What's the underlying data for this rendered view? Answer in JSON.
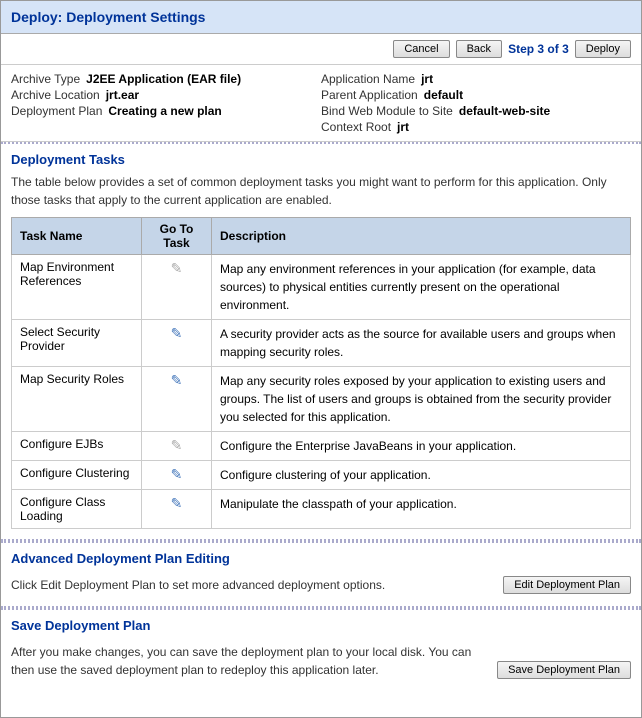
{
  "header": {
    "title": "Deploy: Deployment Settings"
  },
  "topbar": {
    "cancel_label": "Cancel",
    "back_label": "Back",
    "step_text": "Step 3 of 3",
    "deploy_label": "Deploy"
  },
  "info": {
    "left": [
      {
        "label": "Archive Type",
        "value": "J2EE Application (EAR file)"
      },
      {
        "label": "Archive Location",
        "value": "jrt.ear"
      },
      {
        "label": "Deployment Plan",
        "value": "Creating a new plan"
      }
    ],
    "right": [
      {
        "label": "Application Name",
        "value": "jrt"
      },
      {
        "label": "Parent Application",
        "value": "default"
      },
      {
        "label": "Bind Web Module to Site",
        "value": "default-web-site"
      },
      {
        "label": "Context Root",
        "value": "jrt"
      }
    ]
  },
  "deployment_tasks": {
    "section_title": "Deployment Tasks",
    "description": "The table below provides a set of common deployment tasks you might want to perform for this application. Only those tasks that apply to the current application are  enabled.",
    "columns": {
      "task_name": "Task Name",
      "go_to_task": "Go To Task",
      "description": "Description"
    },
    "rows": [
      {
        "task_name": "Map Environment References",
        "enabled": false,
        "description": "Map any environment references in your application (for example, data sources) to physical entities currently present on the operational environment."
      },
      {
        "task_name": "Select Security Provider",
        "enabled": true,
        "description": "A security provider acts as the source for available users and groups when mapping security roles."
      },
      {
        "task_name": "Map Security Roles",
        "enabled": true,
        "description": "Map any security roles exposed by your application to existing users and groups. The list of users and groups is obtained from the security provider you selected for this application."
      },
      {
        "task_name": "Configure EJBs",
        "enabled": false,
        "description": "Configure the Enterprise JavaBeans in your application."
      },
      {
        "task_name": "Configure Clustering",
        "enabled": true,
        "description": "Configure clustering of your application."
      },
      {
        "task_name": "Configure Class Loading",
        "enabled": true,
        "description": "Manipulate the classpath of your application."
      }
    ]
  },
  "advanced_section": {
    "title": "Advanced Deployment Plan Editing",
    "description": "Click Edit Deployment Plan to set more advanced deployment options.",
    "button_label": "Edit Deployment Plan"
  },
  "save_section": {
    "title": "Save Deployment Plan",
    "description": "After you make changes, you can save the deployment plan to your local disk. You can then use the saved deployment plan to redeploy this application later.",
    "button_label": "Save Deployment Plan"
  }
}
